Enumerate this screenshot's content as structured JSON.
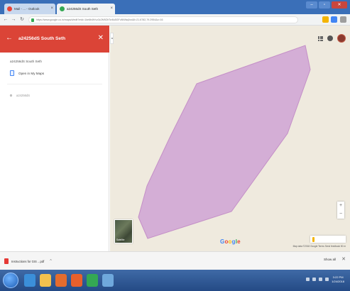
{
  "browser": {
    "tabs": [
      {
        "label": "Mail - ... - Outlook",
        "favicon_color": "#e94335"
      },
      {
        "label": "a24256dS South Seth",
        "favicon_color": "#34a853"
      }
    ],
    "window_controls": {
      "minimize": "–",
      "maximize": "▫",
      "close": "✕"
    },
    "url": "https://www.google.co.in/maps/d/edit?mid=1ke6b4tVvz3c2M9ZbTcr8u5GFuNWkq0xz&ll=21.6782,79.2954&z=16",
    "nav": {
      "back": "←",
      "forward": "→",
      "reload": "↻"
    }
  },
  "sidebar": {
    "header_title": "a24256dS South Seth",
    "back_glyph": "←",
    "close_glyph": "✕",
    "map_name": "a24256dS South Seth",
    "open_in_my_maps": "Open in My Maps",
    "layer_label": "a24256dS",
    "collapse_glyph": "◂"
  },
  "map": {
    "polygon_fill": "#d4aed6",
    "polygon_stroke": "#c48fc7",
    "background": "#efeade",
    "satellite_label": "Satellite",
    "google_letters": [
      "G",
      "o",
      "o",
      "g",
      "l",
      "e"
    ],
    "zoom_in": "+",
    "zoom_out": "−",
    "pegman_label": "",
    "attribution": "Map data ©2018 Google   Terms   Send feedback   50 m"
  },
  "downloads": {
    "file_name": "Instructions for GIS ...pdf",
    "chevron": "^",
    "show_all": "Show all",
    "close_glyph": "✕"
  },
  "taskbar": {
    "icons": [
      {
        "name": "ie-icon",
        "color": "#3b8fd9"
      },
      {
        "name": "explorer-icon",
        "color": "#f2c14e"
      },
      {
        "name": "media-icon",
        "color": "#e46c2e"
      },
      {
        "name": "firefox-icon",
        "color": "#e8602c"
      },
      {
        "name": "chrome-icon",
        "color": "#34a853"
      },
      {
        "name": "app-icon",
        "color": "#6fa8dc"
      }
    ],
    "time": "3:22 PM",
    "date": "1/24/2018"
  }
}
